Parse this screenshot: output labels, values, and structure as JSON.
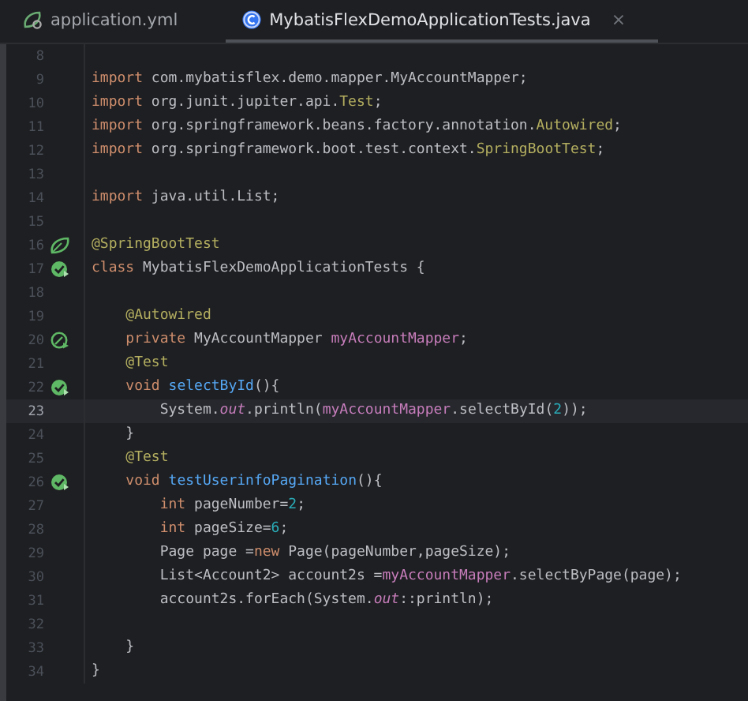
{
  "tabs": [
    {
      "label": "application.yml",
      "kind": "yaml",
      "selected": false
    },
    {
      "label": "MybatisFlexDemoApplicationTests.java",
      "kind": "class",
      "selected": true,
      "close": "×"
    }
  ],
  "editor": {
    "lines": [
      {
        "number": "8",
        "current": false
      },
      {
        "number": "9",
        "current": false,
        "tokens": [
          {
            "kind": "keyword",
            "text": "import"
          },
          {
            "kind": "plain",
            "text": " com.mybatisflex.demo.mapper.MyAccountMapper;"
          }
        ]
      },
      {
        "number": "10",
        "current": false,
        "tokens": [
          {
            "kind": "keyword",
            "text": "import"
          },
          {
            "kind": "plain",
            "text": " org.junit.jupiter.api."
          },
          {
            "kind": "annotation",
            "text": "Test"
          },
          {
            "kind": "plain",
            "text": ";"
          }
        ]
      },
      {
        "number": "11",
        "current": false,
        "tokens": [
          {
            "kind": "keyword",
            "text": "import"
          },
          {
            "kind": "plain",
            "text": " org.springframework.beans.factory.annotation."
          },
          {
            "kind": "annotation",
            "text": "Autowired"
          },
          {
            "kind": "plain",
            "text": ";"
          }
        ]
      },
      {
        "number": "12",
        "current": false,
        "tokens": [
          {
            "kind": "keyword",
            "text": "import"
          },
          {
            "kind": "plain",
            "text": " org.springframework.boot.test.context."
          },
          {
            "kind": "annotation",
            "text": "SpringBootTest"
          },
          {
            "kind": "plain",
            "text": ";"
          }
        ]
      },
      {
        "number": "13",
        "current": false
      },
      {
        "number": "14",
        "current": false,
        "tokens": [
          {
            "kind": "keyword",
            "text": "import"
          },
          {
            "kind": "plain",
            "text": " java.util.List;"
          }
        ]
      },
      {
        "number": "15",
        "current": false
      },
      {
        "number": "16",
        "current": false,
        "gutter": {
          "kind": "bean"
        },
        "tokens": [
          {
            "kind": "annotation",
            "text": "@SpringBootTest"
          }
        ]
      },
      {
        "number": "17",
        "current": false,
        "gutter": {
          "kind": "run"
        },
        "tokens": [
          {
            "kind": "keyword",
            "text": "class"
          },
          {
            "kind": "plain",
            "text": " MybatisFlexDemoApplicationTests {"
          }
        ]
      },
      {
        "number": "18",
        "current": false
      },
      {
        "number": "19",
        "current": false,
        "tokens": [
          {
            "kind": "annotation",
            "text": "    @Autowired"
          }
        ]
      },
      {
        "number": "20",
        "current": false,
        "gutter": {
          "kind": "inject"
        },
        "tokens": [
          {
            "kind": "keyword",
            "text": "    private"
          },
          {
            "kind": "plain",
            "text": " MyAccountMapper "
          },
          {
            "kind": "field",
            "text": "myAccountMapper"
          },
          {
            "kind": "plain",
            "text": ";"
          }
        ]
      },
      {
        "number": "21",
        "current": false,
        "tokens": [
          {
            "kind": "annotation",
            "text": "    @Test"
          }
        ]
      },
      {
        "number": "22",
        "current": false,
        "gutter": {
          "kind": "run"
        },
        "tokens": [
          {
            "kind": "keyword",
            "text": "    void "
          },
          {
            "kind": "declaration",
            "text": "selectById"
          },
          {
            "kind": "plain",
            "text": "(){"
          }
        ]
      },
      {
        "number": "23",
        "current": true,
        "tokens": [
          {
            "kind": "plain",
            "text": "        System."
          },
          {
            "kind": "static",
            "text": "out"
          },
          {
            "kind": "plain",
            "text": ".println("
          },
          {
            "kind": "field",
            "text": "myAccountMapper"
          },
          {
            "kind": "plain",
            "text": ".selectById("
          },
          {
            "kind": "number",
            "text": "2"
          },
          {
            "kind": "plain",
            "text": "));"
          }
        ]
      },
      {
        "number": "24",
        "current": false,
        "tokens": [
          {
            "kind": "plain",
            "text": "    }"
          }
        ]
      },
      {
        "number": "25",
        "current": false,
        "tokens": [
          {
            "kind": "annotation",
            "text": "    @Test"
          }
        ]
      },
      {
        "number": "26",
        "current": false,
        "gutter": {
          "kind": "run"
        },
        "tokens": [
          {
            "kind": "keyword",
            "text": "    void "
          },
          {
            "kind": "declaration",
            "text": "testUserinfoPagination"
          },
          {
            "kind": "plain",
            "text": "(){"
          }
        ]
      },
      {
        "number": "27",
        "current": false,
        "tokens": [
          {
            "kind": "keyword",
            "text": "        int"
          },
          {
            "kind": "plain",
            "text": " pageNumber="
          },
          {
            "kind": "number",
            "text": "2"
          },
          {
            "kind": "plain",
            "text": ";"
          }
        ]
      },
      {
        "number": "28",
        "current": false,
        "tokens": [
          {
            "kind": "keyword",
            "text": "        int"
          },
          {
            "kind": "plain",
            "text": " pageSize="
          },
          {
            "kind": "number",
            "text": "6"
          },
          {
            "kind": "plain",
            "text": ";"
          }
        ]
      },
      {
        "number": "29",
        "current": false,
        "tokens": [
          {
            "kind": "plain",
            "text": "        Page page ="
          },
          {
            "kind": "keyword",
            "text": "new"
          },
          {
            "kind": "plain",
            "text": " Page(pageNumber,pageSize);"
          }
        ]
      },
      {
        "number": "30",
        "current": false,
        "tokens": [
          {
            "kind": "plain",
            "text": "        List<Account2> account2s ="
          },
          {
            "kind": "field",
            "text": "myAccountMapper"
          },
          {
            "kind": "plain",
            "text": ".selectByPage(page);"
          }
        ]
      },
      {
        "number": "31",
        "current": false,
        "tokens": [
          {
            "kind": "plain",
            "text": "        account2s.forEach(System."
          },
          {
            "kind": "static",
            "text": "out"
          },
          {
            "kind": "plain",
            "text": "::println);"
          }
        ]
      },
      {
        "number": "32",
        "current": false
      },
      {
        "number": "33",
        "current": false,
        "tokens": [
          {
            "kind": "plain",
            "text": "    }"
          }
        ]
      },
      {
        "number": "34",
        "current": false,
        "tokens": [
          {
            "kind": "plain",
            "text": "}"
          }
        ]
      }
    ]
  }
}
